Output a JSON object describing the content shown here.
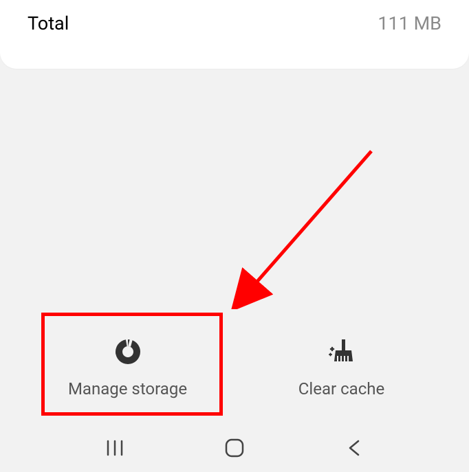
{
  "storage": {
    "total_label": "Total",
    "total_value": "111 MB"
  },
  "actions": {
    "manage_storage_label": "Manage storage",
    "clear_cache_label": "Clear cache"
  },
  "annotation": {
    "highlight_target": "manage-storage-button",
    "arrow_color": "#ff0000",
    "box_color": "#ff0000"
  }
}
